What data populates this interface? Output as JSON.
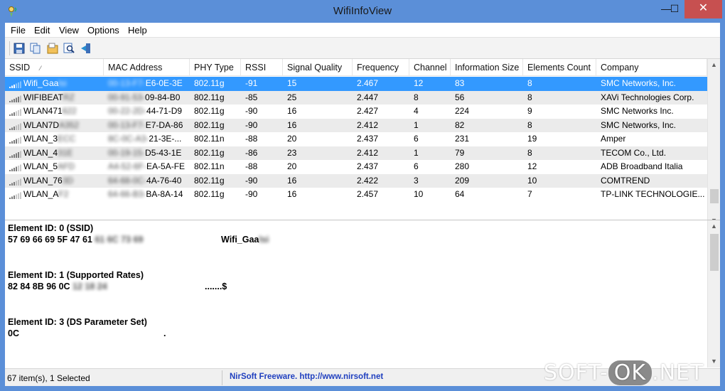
{
  "window": {
    "title": "WifiInfoView",
    "minimize": "—",
    "maximize": "☐",
    "close": "✕"
  },
  "menu": [
    "File",
    "Edit",
    "View",
    "Options",
    "Help"
  ],
  "toolbar": {
    "icons": [
      "save-icon",
      "copy-icon",
      "properties-icon",
      "find-icon",
      "exit-icon"
    ]
  },
  "columns": [
    "SSID",
    "MAC Address",
    "PHY Type",
    "RSSI",
    "Signal Quality",
    "Frequency",
    "Channel",
    "Information Size",
    "Elements Count",
    "Company"
  ],
  "rows": [
    {
      "ssid": "Wifi_Gaa",
      "ssid_blur": "lsi",
      "mac_blur": "00-13-F7-",
      "mac": "E6-0E-3E",
      "phy": "802.11g",
      "rssi": "-91",
      "quality": "15",
      "freq": "2.467",
      "channel": "12",
      "info": "83",
      "elements": "8",
      "company": "SMC Networks, Inc."
    },
    {
      "ssid": "WIFIBEAT",
      "ssid_blur": "RZ",
      "mac_blur": "00-91-53-",
      "mac": "09-84-B0",
      "phy": "802.11g",
      "rssi": "-85",
      "quality": "25",
      "freq": "2.447",
      "channel": "8",
      "info": "56",
      "elements": "8",
      "company": "XAVi Technologies Corp."
    },
    {
      "ssid": "WLAN471",
      "ssid_blur": "622",
      "mac_blur": "00-22-2D-",
      "mac": "44-71-D9",
      "phy": "802.11g",
      "rssi": "-90",
      "quality": "16",
      "freq": "2.427",
      "channel": "4",
      "info": "224",
      "elements": "9",
      "company": "SMC Networks Inc."
    },
    {
      "ssid": "WLAN7D",
      "ssid_blur": "A352",
      "mac_blur": "00-13-F7-",
      "mac": "E7-DA-86",
      "phy": "802.11g",
      "rssi": "-90",
      "quality": "16",
      "freq": "2.412",
      "channel": "1",
      "info": "82",
      "elements": "8",
      "company": "SMC Networks, Inc."
    },
    {
      "ssid": "WLAN_3",
      "ssid_blur": "ECC",
      "mac_blur": "8C-0C-A3-",
      "mac": "21-3E-...",
      "phy": "802.11n",
      "rssi": "-88",
      "quality": "20",
      "freq": "2.437",
      "channel": "6",
      "info": "231",
      "elements": "19",
      "company": "Amper"
    },
    {
      "ssid": "WLAN_4",
      "ssid_blur": "31E",
      "mac_blur": "00-19-15-",
      "mac": "D5-43-1E",
      "phy": "802.11g",
      "rssi": "-86",
      "quality": "23",
      "freq": "2.412",
      "channel": "1",
      "info": "79",
      "elements": "8",
      "company": "TECOM Co., Ltd."
    },
    {
      "ssid": "WLAN_5",
      "ssid_blur": "AFD",
      "mac_blur": "A4-52-6F-",
      "mac": "EA-5A-FE",
      "phy": "802.11n",
      "rssi": "-88",
      "quality": "20",
      "freq": "2.437",
      "channel": "6",
      "info": "280",
      "elements": "12",
      "company": "ADB Broadband Italia"
    },
    {
      "ssid": "WLAN_76",
      "ssid_blur": "3D",
      "mac_blur": "64-68-0C-",
      "mac": "4A-76-40",
      "phy": "802.11g",
      "rssi": "-90",
      "quality": "16",
      "freq": "2.422",
      "channel": "3",
      "info": "209",
      "elements": "10",
      "company": "COMTREND"
    },
    {
      "ssid": "WLAN_A",
      "ssid_blur": "F2",
      "mac_blur": "64-66-B3-",
      "mac": "BA-8A-14",
      "phy": "802.11g",
      "rssi": "-90",
      "quality": "16",
      "freq": "2.457",
      "channel": "10",
      "info": "64",
      "elements": "7",
      "company": "TP-LINK TECHNOLOGIE..."
    }
  ],
  "details": [
    {
      "title": "Element ID: 0  (SSID)",
      "hex": "57 69 66 69 5F 47 61",
      "hex_blur": "61 6C 73 69",
      "ascii": "Wifi_Gaa",
      "ascii_blur": "lsi"
    },
    {
      "title": "Element ID: 1  (Supported Rates)",
      "hex": "82 84 8B 96 0C",
      "hex_blur": "12 18 24",
      "ascii": ".......$",
      "ascii_blur": ""
    },
    {
      "title": "Element ID: 3  (DS Parameter Set)",
      "hex": "0C",
      "hex_blur": "",
      "ascii": ".",
      "ascii_blur": ""
    }
  ],
  "status": {
    "count": "67 item(s), 1 Selected",
    "link": "NirSoft Freeware.  http://www.nirsoft.net"
  },
  "watermark": {
    "left": "SOFT-",
    "mid": "OK",
    "right": ".NET"
  },
  "colors": {
    "titlebar": "#5b8fd8",
    "selection": "#3399ff",
    "close": "#c75050",
    "link": "#1f3fbf"
  }
}
